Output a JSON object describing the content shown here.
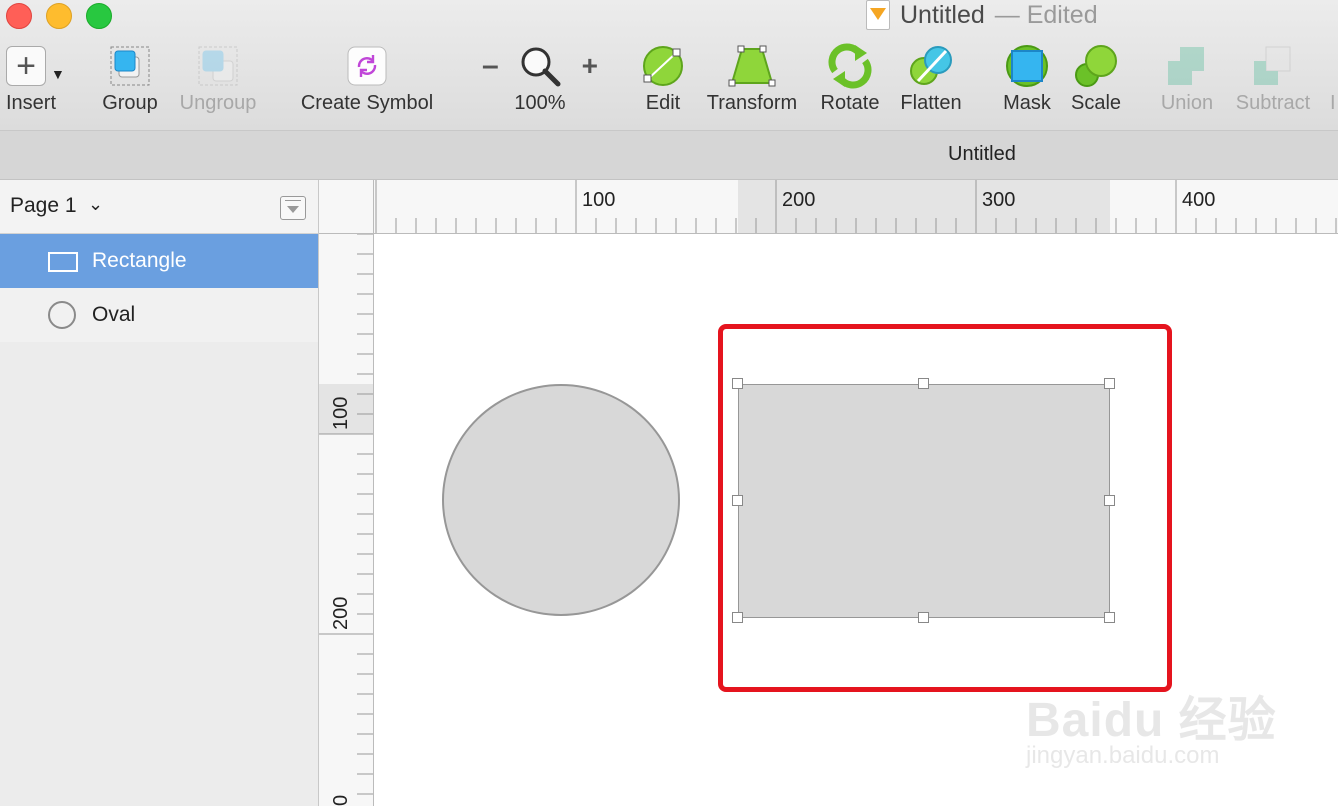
{
  "window": {
    "title": "Untitled",
    "title_suffix": "— Edited"
  },
  "toolbar": {
    "insert": "Insert",
    "group": "Group",
    "ungroup": "Ungroup",
    "create_symbol": "Create Symbol",
    "zoom_minus": "–",
    "zoom_plus": "+",
    "zoom_level": "100%",
    "edit": "Edit",
    "transform": "Transform",
    "rotate": "Rotate",
    "flatten": "Flatten",
    "mask": "Mask",
    "scale": "Scale",
    "union": "Union",
    "subtract": "Subtract",
    "intersect_partial": "I"
  },
  "tabbar": {
    "title": "Untitled"
  },
  "layers": {
    "page": "Page 1",
    "items": [
      {
        "label": "Rectangle",
        "icon": "rectangle-icon",
        "selected": true
      },
      {
        "label": "Oval",
        "icon": "oval-icon",
        "selected": false
      }
    ]
  },
  "rulers": {
    "top_labels": [
      "100",
      "200",
      "300",
      "400"
    ],
    "left_labels": [
      "100",
      "200",
      "0"
    ]
  },
  "colors": {
    "selection_blue": "#6a9fe0",
    "highlight_red": "#e5141e",
    "shape_fill": "#d8d8d8",
    "shape_stroke": "#979797"
  },
  "watermark": {
    "brand": "Baidu 经验",
    "url": "jingyan.baidu.com"
  }
}
